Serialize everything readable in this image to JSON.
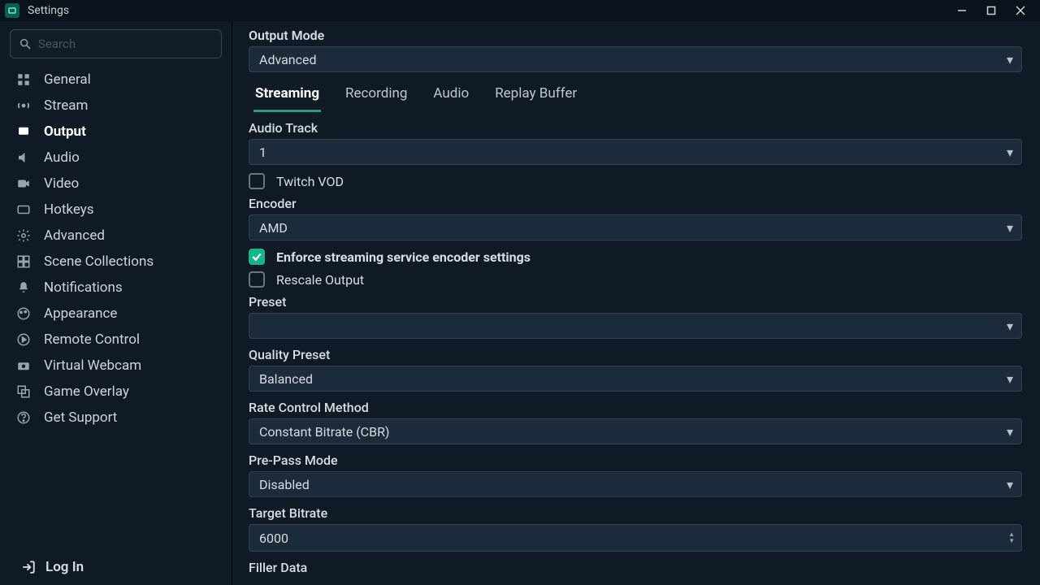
{
  "window": {
    "title": "Settings"
  },
  "search": {
    "placeholder": "Search"
  },
  "sidebar": {
    "items": [
      {
        "label": "General"
      },
      {
        "label": "Stream"
      },
      {
        "label": "Output"
      },
      {
        "label": "Audio"
      },
      {
        "label": "Video"
      },
      {
        "label": "Hotkeys"
      },
      {
        "label": "Advanced"
      },
      {
        "label": "Scene Collections"
      },
      {
        "label": "Notifications"
      },
      {
        "label": "Appearance"
      },
      {
        "label": "Remote Control"
      },
      {
        "label": "Virtual Webcam"
      },
      {
        "label": "Game Overlay"
      },
      {
        "label": "Get Support"
      }
    ],
    "login": "Log In"
  },
  "main": {
    "output_mode": {
      "label": "Output Mode",
      "value": "Advanced"
    },
    "tabs": [
      {
        "label": "Streaming"
      },
      {
        "label": "Recording"
      },
      {
        "label": "Audio"
      },
      {
        "label": "Replay Buffer"
      }
    ],
    "audio_track": {
      "label": "Audio Track",
      "value": "1"
    },
    "twitch_vod": {
      "label": "Twitch VOD",
      "checked": false
    },
    "encoder": {
      "label": "Encoder",
      "value": "AMD"
    },
    "enforce": {
      "label": "Enforce streaming service encoder settings",
      "checked": true
    },
    "rescale": {
      "label": "Rescale Output",
      "checked": false
    },
    "preset": {
      "label": "Preset",
      "value": ""
    },
    "quality_preset": {
      "label": "Quality Preset",
      "value": "Balanced"
    },
    "rate_control": {
      "label": "Rate Control Method",
      "value": "Constant Bitrate (CBR)"
    },
    "prepass": {
      "label": "Pre-Pass Mode",
      "value": "Disabled"
    },
    "target_bitrate": {
      "label": "Target Bitrate",
      "value": "6000"
    },
    "filler_data": {
      "label": "Filler Data"
    }
  }
}
